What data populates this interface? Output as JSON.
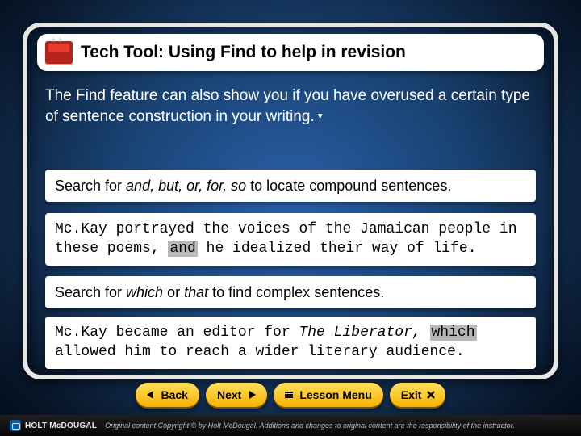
{
  "title": "Tech Tool: Using Find to help in revision",
  "intro": "The Find feature can also show you if you have overused a certain type of sentence construction in your writing.",
  "box1": {
    "prefix": "Search for ",
    "italic": "and, but, or, for, so",
    "suffix": " to locate compound sentences."
  },
  "box2": {
    "pre": "Mc.Kay portrayed the voices of the Jamaican people in these poems, ",
    "hl": "and",
    "post": " he idealized their way of life."
  },
  "box3": {
    "prefix": "Search for ",
    "i1": "which",
    "mid": " or ",
    "i2": "that",
    "suffix": " to find complex sentences."
  },
  "box4": {
    "pre": "Mc.Kay became an editor for ",
    "title": "The Liberator,",
    "sp": " ",
    "hl": "which",
    "post": " allowed him to reach a wider literary audience."
  },
  "nav": {
    "back": "Back",
    "next": "Next",
    "lesson": "Lesson Menu",
    "exit": "Exit"
  },
  "footer": {
    "brand": "HOLT McDOUGAL",
    "legal": "Original content Copyright © by Holt McDougal. Additions and changes to original content are the responsibility of the instructor."
  }
}
